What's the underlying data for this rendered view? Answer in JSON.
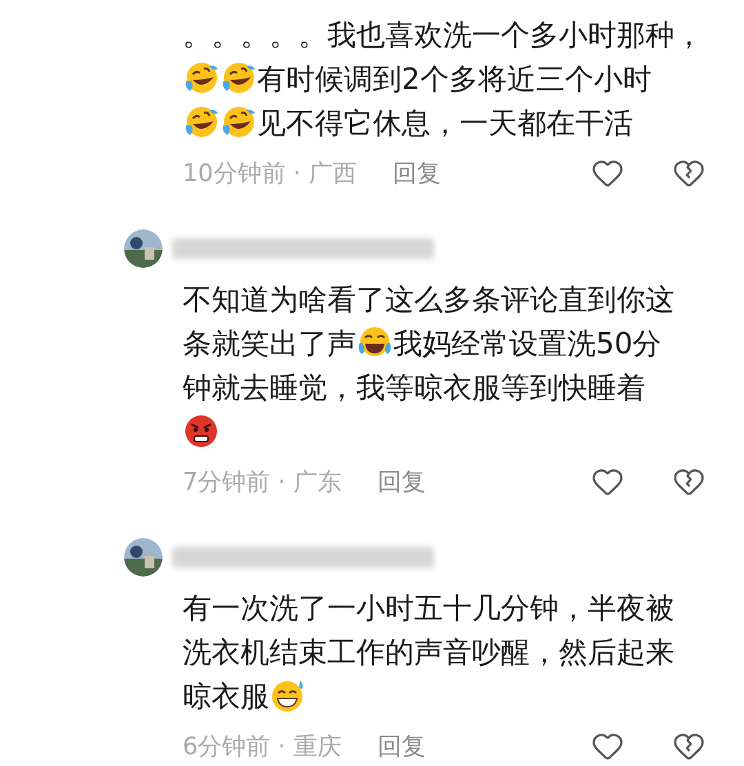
{
  "comments": [
    {
      "kind": "continued",
      "lines": [
        [
          {
            "kind": "text",
            "text": "。。。。。我也喜欢洗一个多小时那种，"
          }
        ],
        [
          {
            "kind": "tilt-laugh"
          },
          {
            "kind": "tilt-laugh"
          },
          {
            "kind": "text",
            "text": "有时候调到2个多将近三个小时"
          }
        ],
        [
          {
            "kind": "tilt-laugh"
          },
          {
            "kind": "tilt-laugh"
          },
          {
            "kind": "text",
            "text": "见不得它休息，一天都在干活"
          }
        ]
      ],
      "time": "10分钟前 · 广西",
      "reply": "回复"
    },
    {
      "kind": "full",
      "lines": [
        [
          {
            "kind": "text",
            "text": "不知道为啥看了这么多条评论直到你这"
          }
        ],
        [
          {
            "kind": "text",
            "text": "条就笑出了声"
          },
          {
            "kind": "cry-laugh"
          },
          {
            "kind": "text",
            "text": "我妈经常设置洗50分"
          }
        ],
        [
          {
            "kind": "text",
            "text": "钟就去睡觉，我等晾衣服等到快睡着"
          }
        ],
        [
          {
            "kind": "angry"
          }
        ]
      ],
      "time": "7分钟前 · 广东",
      "reply": "回复"
    },
    {
      "kind": "full",
      "lines": [
        [
          {
            "kind": "text",
            "text": "有一次洗了一小时五十几分钟，半夜被"
          }
        ],
        [
          {
            "kind": "text",
            "text": "洗衣机结束工作的声音吵醒，然后起来"
          }
        ],
        [
          {
            "kind": "text",
            "text": "晾衣服"
          },
          {
            "kind": "sweat-grin"
          }
        ]
      ],
      "time": "6分钟前 · 重庆",
      "reply": "回复"
    }
  ]
}
